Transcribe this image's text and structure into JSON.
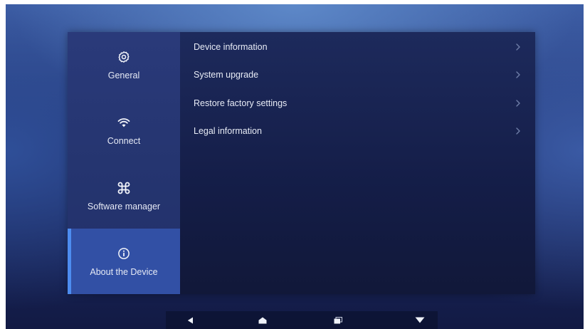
{
  "sidebar": {
    "items": [
      {
        "label": "General",
        "icon": "gear-icon"
      },
      {
        "label": "Connect",
        "icon": "wifi-icon"
      },
      {
        "label": "Software manager",
        "icon": "command-icon"
      },
      {
        "label": "About the Device",
        "icon": "info-icon",
        "active": true
      }
    ]
  },
  "content": {
    "items": [
      {
        "label": "Device information"
      },
      {
        "label": "System upgrade"
      },
      {
        "label": "Restore factory settings"
      },
      {
        "label": "Legal information"
      }
    ]
  },
  "navbar": {
    "buttons": [
      "back-icon",
      "home-icon",
      "recents-icon",
      "dropdown-icon"
    ]
  },
  "colors": {
    "accent": "#4d8cf0",
    "active_bg": "#3250a5",
    "sidebar_bg": "#253570",
    "panel_bg": "#161f4c",
    "text": "#e8ecf6"
  }
}
